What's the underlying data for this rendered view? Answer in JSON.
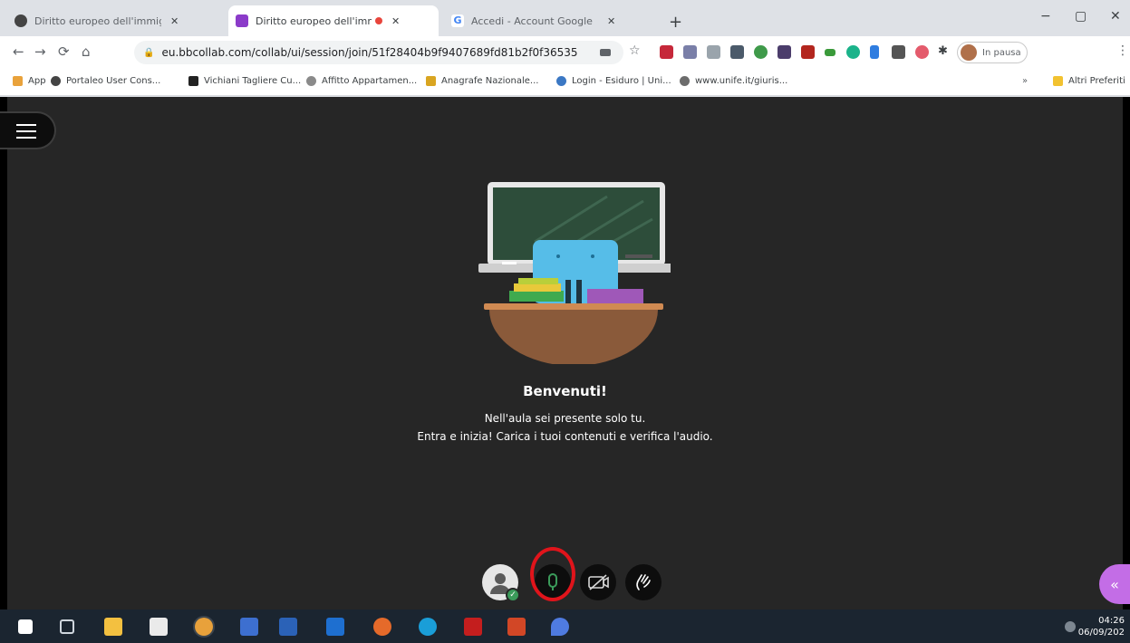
{
  "browser": {
    "tabs": [
      {
        "title": "Diritto europeo dell'immigrazio",
        "active": false,
        "recording": false,
        "icon": "globe-icon"
      },
      {
        "title": "Diritto europeo dell'immigra",
        "active": true,
        "recording": true,
        "icon": "collab-icon"
      },
      {
        "title": "Accedi - Account Google",
        "active": false,
        "recording": false,
        "icon": "google-icon"
      }
    ],
    "new_tab_label": "+",
    "window_controls": {
      "minimize": "−",
      "maximize": "▢",
      "close": "✕"
    },
    "nav": {
      "back": "←",
      "forward": "→",
      "reload": "⟳",
      "home": "⌂"
    },
    "url": "eu.bbcollab.com/collab/ui/session/join/51f28404b9f9407689fd81b2f0f36535",
    "profile_label": "In pausa",
    "bookmarks": [
      {
        "label": "App",
        "color": "#e9a23b"
      },
      {
        "label": "Portaleo User Cons...",
        "color": "#444444"
      },
      {
        "label": "Vichiani Tagliere Cu...",
        "color": "#222222"
      },
      {
        "label": "Affitto Appartamen...",
        "color": "#8a8a8a"
      },
      {
        "label": "Anagrafe Nazionale...",
        "color": "#d9a521"
      },
      {
        "label": "Login - Esiduro | Uni...",
        "color": "#3b78c4"
      },
      {
        "label": "www.unife.it/giuris...",
        "color": "#6c6c6c"
      }
    ],
    "other_bookmarks": "Altri Preferiti"
  },
  "session": {
    "welcome_title": "Benvenuti!",
    "welcome_line_1": "Nell'aula sei presente solo tu.",
    "welcome_line_2": "Entra e inizia! Carica i tuoi contenuti e verifica l'audio.",
    "controls": [
      "avatar",
      "microphone",
      "camera-off",
      "raise-hand"
    ]
  },
  "colors": {
    "stage_bg": "#262626",
    "accent_green": "#3b9a5a",
    "highlight_ring": "#e0141b",
    "collapse_purple": "#c36de6"
  },
  "taskbar": {
    "time": "04:26",
    "date": "06/09/202"
  }
}
